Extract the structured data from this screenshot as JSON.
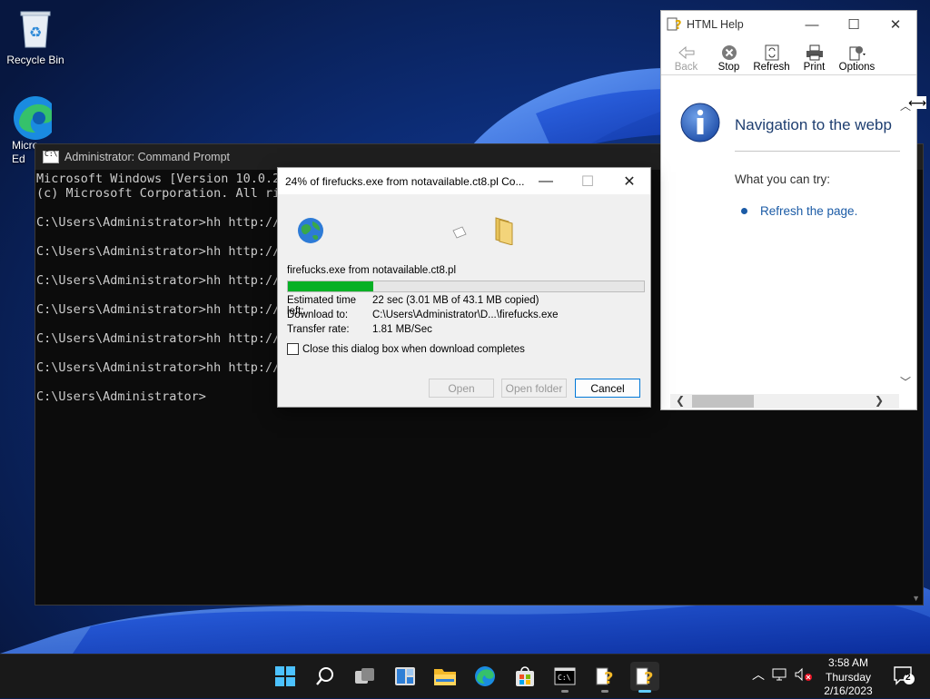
{
  "desktop": {
    "icons": [
      {
        "label": "Recycle Bin"
      },
      {
        "label": "Micro Ed"
      }
    ]
  },
  "cmd": {
    "title": "Administrator: Command Prompt",
    "lines": [
      "Microsoft Windows [Version 10.0.2",
      "(c) Microsoft Corporation. All ri",
      "",
      "C:\\Users\\Administrator>hh http://",
      "",
      "C:\\Users\\Administrator>hh http://",
      "",
      "C:\\Users\\Administrator>hh http://",
      "",
      "C:\\Users\\Administrator>hh http://",
      "",
      "C:\\Users\\Administrator>hh http://",
      "",
      "C:\\Users\\Administrator>hh http://",
      "",
      "C:\\Users\\Administrator>"
    ]
  },
  "download": {
    "title": "24% of firefucks.exe from notavailable.ct8.pl Co...",
    "filename": "firefucks.exe from notavailable.ct8.pl",
    "progress_percent": 24,
    "rows": [
      {
        "label": "Estimated time left:",
        "value": "22 sec (3.01 MB of 43.1 MB copied)"
      },
      {
        "label": "Download to:",
        "value": "C:\\Users\\Administrator\\D...\\firefucks.exe"
      },
      {
        "label": "Transfer rate:",
        "value": "1.81 MB/Sec"
      }
    ],
    "checkbox_label": "Close this dialog box when download completes",
    "checkbox_checked": false,
    "buttons": {
      "open": "Open",
      "open_folder": "Open folder",
      "cancel": "Cancel"
    }
  },
  "help": {
    "title": "HTML Help",
    "toolbar": [
      {
        "label": "Back",
        "enabled": false
      },
      {
        "label": "Stop",
        "enabled": true
      },
      {
        "label": "Refresh",
        "enabled": true
      },
      {
        "label": "Print",
        "enabled": true
      },
      {
        "label": "Options",
        "enabled": true
      }
    ],
    "heading": "Navigation to the webp",
    "try_text": "What you can try:",
    "link": "Refresh the page."
  },
  "taskbar": {
    "time": "3:58 AM",
    "day": "Thursday",
    "date": "2/16/2023",
    "notifications": "2"
  },
  "colors": {
    "accent": "#0078d7",
    "progress_fill": "#06b025",
    "help_heading": "#1e3e70",
    "link": "#1b5ba6"
  }
}
